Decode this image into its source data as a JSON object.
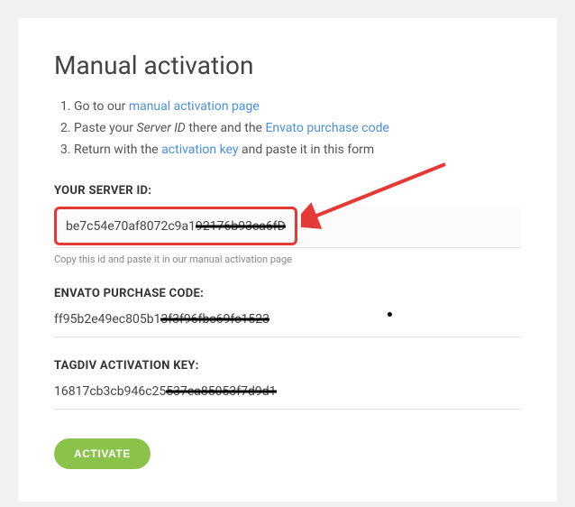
{
  "title": "Manual activation",
  "steps": {
    "s1_prefix": "Go to our ",
    "s1_link": "manual activation page",
    "s2_prefix": "Paste your ",
    "s2_em": "Server ID",
    "s2_mid": " there and the ",
    "s2_link": "Envato purchase code",
    "s3_prefix": "Return with the ",
    "s3_link": "activation key",
    "s3_suffix": " and paste it in this form"
  },
  "server": {
    "label": "YOUR SERVER ID:",
    "visible": "be7c54e70af8072c9a1",
    "redacted": "92176b93ca6fD",
    "helper": "Copy this id and paste it in our manual activation page"
  },
  "purchase": {
    "label": "ENVATO PURCHASE CODE:",
    "visible": "ff95b2e49ec805b1",
    "redacted": "3f3f96fbc69fc1523"
  },
  "activation_key": {
    "label": "TAGDIV ACTIVATION KEY:",
    "visible": "16817cb3cb946c25",
    "redacted": "537ea85053f7d9d1"
  },
  "button": "ACTIVATE",
  "colors": {
    "accent_red": "#e53935",
    "link": "#4a90d9",
    "button": "#8bc34a"
  }
}
